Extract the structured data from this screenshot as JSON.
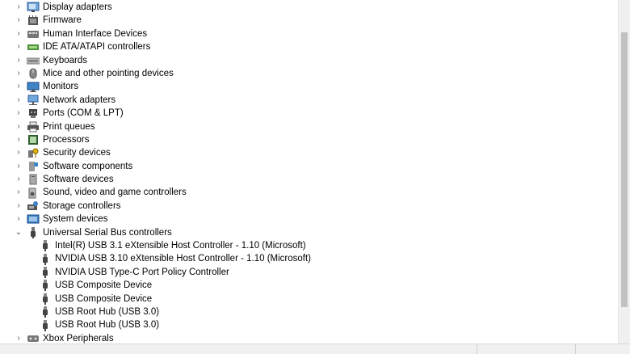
{
  "categories": [
    {
      "label": "Display adapters",
      "icon": "display-adapter-icon",
      "expanded": false
    },
    {
      "label": "Firmware",
      "icon": "firmware-icon",
      "expanded": false
    },
    {
      "label": "Human Interface Devices",
      "icon": "hid-icon",
      "expanded": false
    },
    {
      "label": "IDE ATA/ATAPI controllers",
      "icon": "ide-controller-icon",
      "expanded": false
    },
    {
      "label": "Keyboards",
      "icon": "keyboard-icon",
      "expanded": false
    },
    {
      "label": "Mice and other pointing devices",
      "icon": "mouse-icon",
      "expanded": false
    },
    {
      "label": "Monitors",
      "icon": "monitor-icon",
      "expanded": false
    },
    {
      "label": "Network adapters",
      "icon": "network-adapter-icon",
      "expanded": false
    },
    {
      "label": "Ports (COM & LPT)",
      "icon": "port-icon",
      "expanded": false
    },
    {
      "label": "Print queues",
      "icon": "printer-icon",
      "expanded": false
    },
    {
      "label": "Processors",
      "icon": "processor-icon",
      "expanded": false
    },
    {
      "label": "Security devices",
      "icon": "security-device-icon",
      "expanded": false
    },
    {
      "label": "Software components",
      "icon": "software-component-icon",
      "expanded": false
    },
    {
      "label": "Software devices",
      "icon": "software-device-icon",
      "expanded": false
    },
    {
      "label": "Sound, video and game controllers",
      "icon": "speaker-icon",
      "expanded": false
    },
    {
      "label": "Storage controllers",
      "icon": "storage-controller-icon",
      "expanded": false
    },
    {
      "label": "System devices",
      "icon": "system-device-icon",
      "expanded": false
    },
    {
      "label": "Universal Serial Bus controllers",
      "icon": "usb-icon",
      "expanded": true
    }
  ],
  "usb_children": [
    "Intel(R) USB 3.1 eXtensible Host Controller - 1.10 (Microsoft)",
    "NVIDIA USB 3.10 eXtensible Host Controller - 1.10 (Microsoft)",
    "NVIDIA USB Type-C Port Policy Controller",
    "USB Composite Device",
    "USB Composite Device",
    "USB Root Hub (USB 3.0)",
    "USB Root Hub (USB 3.0)"
  ],
  "after": [
    {
      "label": "Xbox Peripherals",
      "icon": "xbox-peripheral-icon",
      "expanded": false
    }
  ],
  "glyphs": {
    "collapsed": "›",
    "expanded": "⌄"
  }
}
